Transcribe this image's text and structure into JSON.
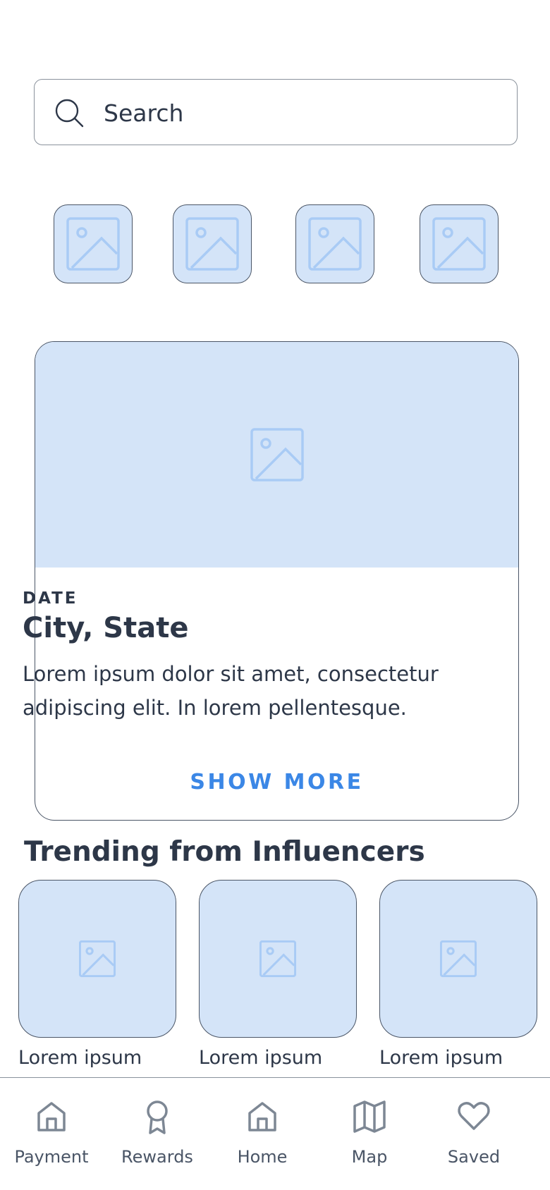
{
  "search": {
    "placeholder": "Search",
    "icon": "search-icon"
  },
  "categories": [
    {
      "icon": "image-placeholder-icon"
    },
    {
      "icon": "image-placeholder-icon"
    },
    {
      "icon": "image-placeholder-icon"
    },
    {
      "icon": "image-placeholder-icon"
    }
  ],
  "featured_card": {
    "date": "DATE",
    "title": "City, State",
    "body": "Lorem ipsum dolor sit amet, consectetur adipiscing elit. In lorem pellentesque.",
    "button": "SHOW MORE"
  },
  "trending": {
    "title": "Trending from Influencers",
    "items": [
      {
        "label": "Lorem ipsum"
      },
      {
        "label": "Lorem ipsum"
      },
      {
        "label": "Lorem ipsum"
      }
    ]
  },
  "bottom_nav": [
    {
      "label": "Payment",
      "icon": "home-icon"
    },
    {
      "label": "Rewards",
      "icon": "award-icon"
    },
    {
      "label": "Home",
      "icon": "home-icon"
    },
    {
      "label": "Map",
      "icon": "map-icon"
    },
    {
      "label": "Saved",
      "icon": "heart-icon"
    }
  ],
  "colors": {
    "placeholder_bg": "#d4e4f8",
    "placeholder_stroke": "#a9cbf5",
    "accent": "#3b87e6",
    "text": "#2d3748",
    "nav_icon": "#7d8794"
  }
}
